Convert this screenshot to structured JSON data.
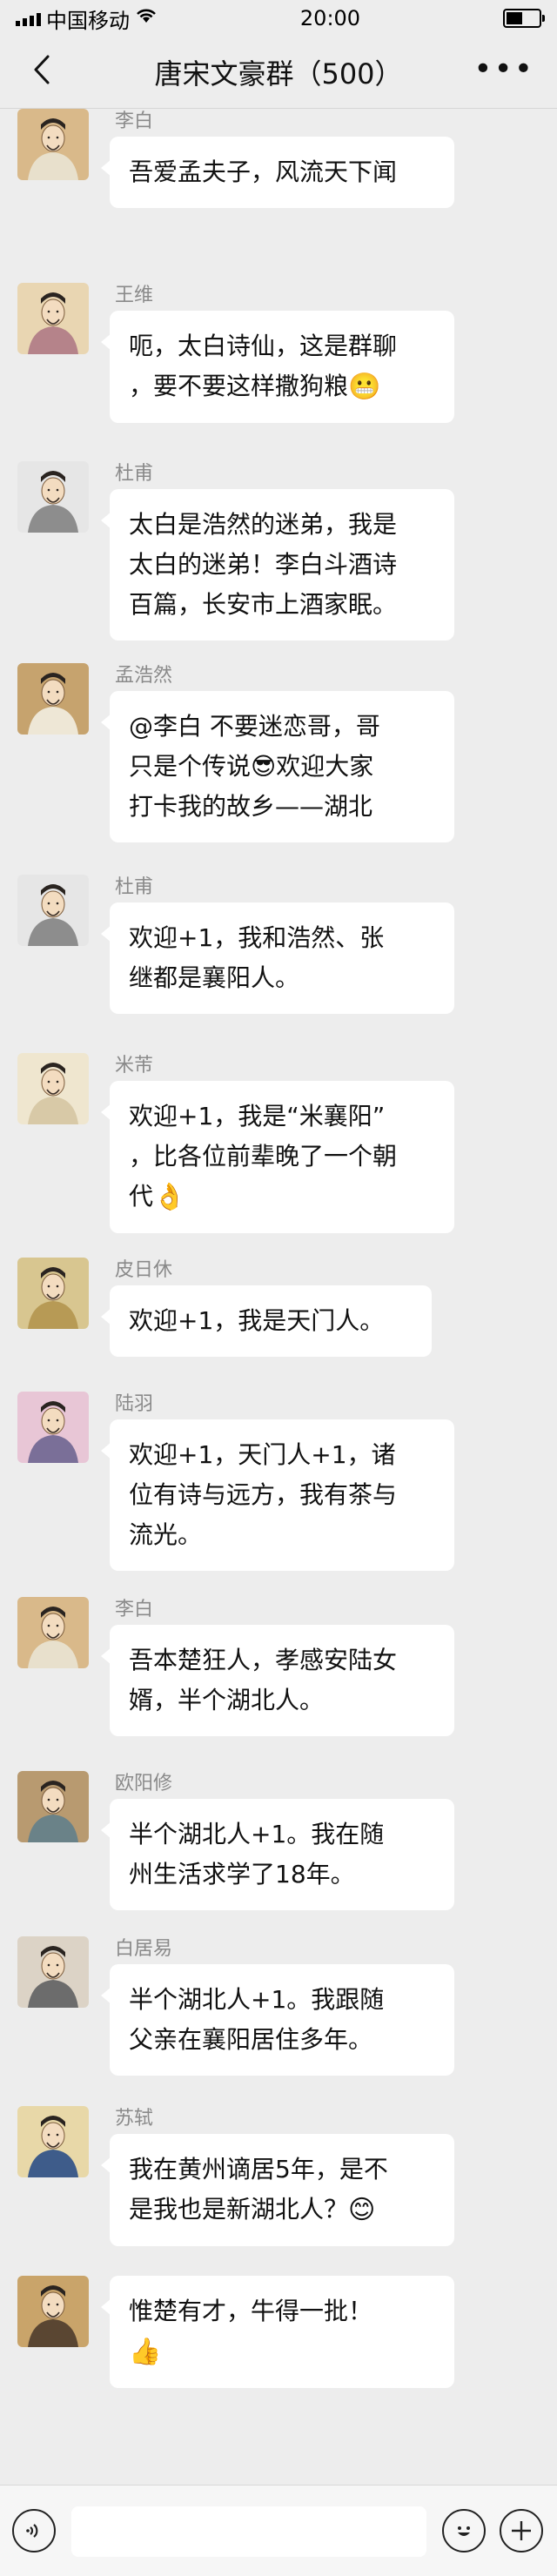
{
  "status": {
    "carrier": "中国移动",
    "time": "20:00"
  },
  "header": {
    "title": "唐宋文豪群（500）",
    "more": "•••"
  },
  "messages": [
    {
      "sender": "李白",
      "lines": [
        "吾爱孟夫子，风流天下闻"
      ]
    },
    {
      "sender": "王维",
      "lines": [
        "呃，太白诗仙，这是群聊",
        "，要不要这样撒狗粮"
      ],
      "emoji": "😬"
    },
    {
      "sender": "杜甫",
      "lines": [
        "太白是浩然的迷弟，我是",
        "太白的迷弟！李白斗酒诗",
        "百篇，长安市上酒家眠。"
      ]
    },
    {
      "sender": "孟浩然",
      "lines": [
        "@李白 不要迷恋哥，哥",
        "只是个传说😎欢迎大家",
        "打卡我的故乡——湖北"
      ]
    },
    {
      "sender": "杜甫",
      "lines": [
        "欢迎+1，我和浩然、张",
        "继都是襄阳人。"
      ]
    },
    {
      "sender": "米芾",
      "lines": [
        "欢迎+1，我是“米襄阳”",
        "，比各位前辈晚了一个朝",
        "代"
      ],
      "emoji": "👌"
    },
    {
      "sender": "皮日休",
      "lines": [
        "欢迎+1，我是天门人。"
      ]
    },
    {
      "sender": "陆羽",
      "lines": [
        "欢迎+1，天门人+1，诸",
        "位有诗与远方，我有茶与",
        "流光。"
      ]
    },
    {
      "sender": "李白",
      "lines": [
        "吾本楚狂人，孝感安陆女",
        "婿，半个湖北人。"
      ]
    },
    {
      "sender": "欧阳修",
      "lines": [
        "半个湖北人+1。我在随",
        "州生活求学了18年。"
      ]
    },
    {
      "sender": "白居易",
      "lines": [
        "半个湖北人+1。我跟随",
        "父亲在襄阳居住多年。"
      ]
    },
    {
      "sender": "苏轼",
      "lines": [
        "我在黄州谪居5年，是不",
        "是我也是新湖北人？"
      ],
      "emoji": "😊"
    },
    {
      "sender": "",
      "lines": [
        "惟楚有才，牛得一批！"
      ],
      "emoji": "👍"
    }
  ],
  "avatars": [
    {
      "name": "libai-portrait-icon",
      "bg": "#d9b98a",
      "robe": "#e8e0cc"
    },
    {
      "name": "wangwei-portrait-icon",
      "bg": "#e9d6b2",
      "robe": "#b5838a"
    },
    {
      "name": "dufu-portrait-icon",
      "bg": "#e6e6e6",
      "robe": "#8d8d8d"
    },
    {
      "name": "menghaoran-portrait-icon",
      "bg": "#c6a36e",
      "robe": "#eee7d6"
    },
    {
      "name": "dufu-portrait-icon",
      "bg": "#e6e6e6",
      "robe": "#8d8d8d"
    },
    {
      "name": "mifu-portrait-icon",
      "bg": "#efe6cf",
      "robe": "#d8c9a7"
    },
    {
      "name": "pirixiu-portrait-icon",
      "bg": "#d8c690",
      "robe": "#b79a55"
    },
    {
      "name": "luyu-portrait-icon",
      "bg": "#e8c6d6",
      "robe": "#7a6f98"
    },
    {
      "name": "libai-portrait-icon",
      "bg": "#d9b98a",
      "robe": "#e8e0cc"
    },
    {
      "name": "ouyangxiu-portrait-icon",
      "bg": "#b89a70",
      "robe": "#6a8288"
    },
    {
      "name": "baijuyi-portrait-icon",
      "bg": "#dcd3c6",
      "robe": "#6c6c6c"
    },
    {
      "name": "sushi-portrait-icon",
      "bg": "#e8d8a8",
      "robe": "#3e5c8a"
    },
    {
      "name": "portrait-icon",
      "bg": "#c9a46a",
      "robe": "#5a4632"
    }
  ]
}
